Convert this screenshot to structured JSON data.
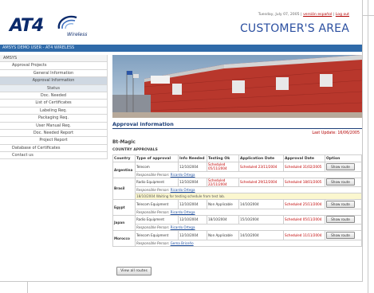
{
  "header": {
    "logo_text": "AT4",
    "logo_sub": "Wireless",
    "date": "Tuesday, July 07, 2005",
    "separator": "|",
    "lang_link": "versión español",
    "logout_link": "Log out",
    "area_title": "CUSTOMER'S AREA"
  },
  "userbar": {
    "label": "AMSYS DEMO USER - AT4 WIRELESS"
  },
  "nav": {
    "items": [
      {
        "label": "AMSYS"
      },
      {
        "label": "Approval Projects"
      },
      {
        "label": "General Information"
      },
      {
        "label": "Approval Information"
      },
      {
        "label": "Status"
      },
      {
        "label": "Doc. Needed"
      },
      {
        "label": "List of Certificates"
      },
      {
        "label": "Labeling Req."
      },
      {
        "label": "Packaging Req."
      },
      {
        "label": "User Manual Req."
      },
      {
        "label": "Doc. Needed Report"
      },
      {
        "label": "Project Report"
      },
      {
        "label": "Database of Certificates"
      },
      {
        "label": "Contact us"
      }
    ]
  },
  "main": {
    "title": "Approval information",
    "last_update": "Last Update: 16/06/2005",
    "product": "Bt-Magic",
    "section": "COUNTRY APPROVALS",
    "columns": [
      "Country",
      "Type of approval",
      "Info Needed",
      "Testing Ok",
      "Application Date",
      "Approval Date",
      "Option"
    ],
    "resp_label": "Responsible Person:",
    "route_button": "Show route",
    "rows": [
      {
        "country": "Argentina",
        "type": "Telecom",
        "info": "12/10/2004",
        "testing": "Scheduled 05/11/2004",
        "application": "Scheduled 23/11/2004",
        "approval": "Scheduled 31/02/2005",
        "person": "Ricardo Ortega"
      },
      {
        "country": "Brasil",
        "type": "Radio Equipment",
        "info": "12/10/2004",
        "testing": "Scheduled 22/11/2004",
        "application": "Scheduled 29/12/2004",
        "approval": "Scheduled 18/01/2005",
        "person": "Ricardo Ortega",
        "note": "18/10/2004 Waiting for testing schedule from test lab."
      },
      {
        "country": "Egypt",
        "type": "Telecom Equipment",
        "info": "12/10/2004",
        "testing": "Non Applicable",
        "application": "14/10/2004",
        "approval": "Scheduled 25/11/2004",
        "person": "Ricardo Ortega"
      },
      {
        "country": "Japan",
        "type": "Radio Equipment",
        "info": "12/10/2004",
        "testing": "18/10/2004",
        "application": "15/10/2004",
        "approval": "Scheduled 05/11/2004",
        "person": "Ricardo Ortega"
      },
      {
        "country": "Morocco",
        "type": "Telecom Equipment",
        "info": "12/10/2004",
        "testing": "Non Applicable",
        "application": "14/10/2004",
        "approval": "Scheduled 11/11/2004",
        "person": "Gema Briceño"
      }
    ],
    "view_all": "View all routes"
  }
}
